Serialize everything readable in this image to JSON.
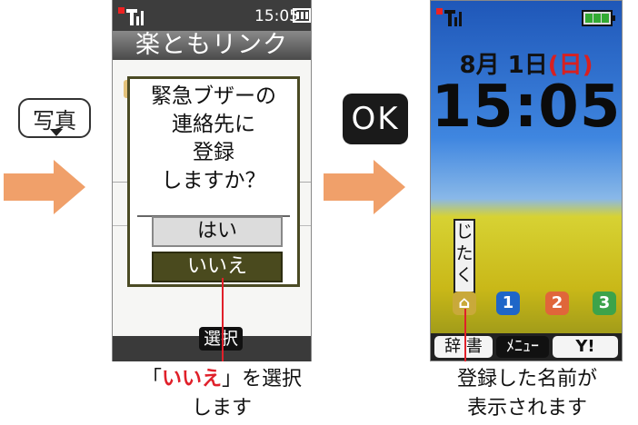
{
  "keys": {
    "shashin": "写真",
    "ok": "OK"
  },
  "phone1": {
    "status_time": "15:05",
    "title": "楽ともリンク",
    "dialog_lines": [
      "緊急ブザーの",
      "連絡先に",
      "登録",
      "しますか？"
    ],
    "btn_yes": "はい",
    "btn_no": "いいえ",
    "softkey": "選択"
  },
  "phone2": {
    "date_month": "8月",
    "date_day": "1日",
    "date_weekday": "(日)",
    "time": "15:05",
    "jitaku": [
      "じ",
      "た",
      "く"
    ],
    "shortcuts": [
      "1",
      "2",
      "3"
    ],
    "softkeys": [
      "辞 書",
      "ﾒﾆｭｰ",
      "Y!"
    ]
  },
  "caption_left": {
    "quote_open": "「",
    "highlight": "いいえ",
    "rest_line1": "」を選択",
    "line2": "します"
  },
  "caption_right": {
    "line1": "登録した名前が",
    "line2": "表示されます"
  },
  "colors": {
    "arrow": "#f0a06a",
    "pointer": "#e0202a",
    "dialog_selected": "#4a4a1e"
  }
}
